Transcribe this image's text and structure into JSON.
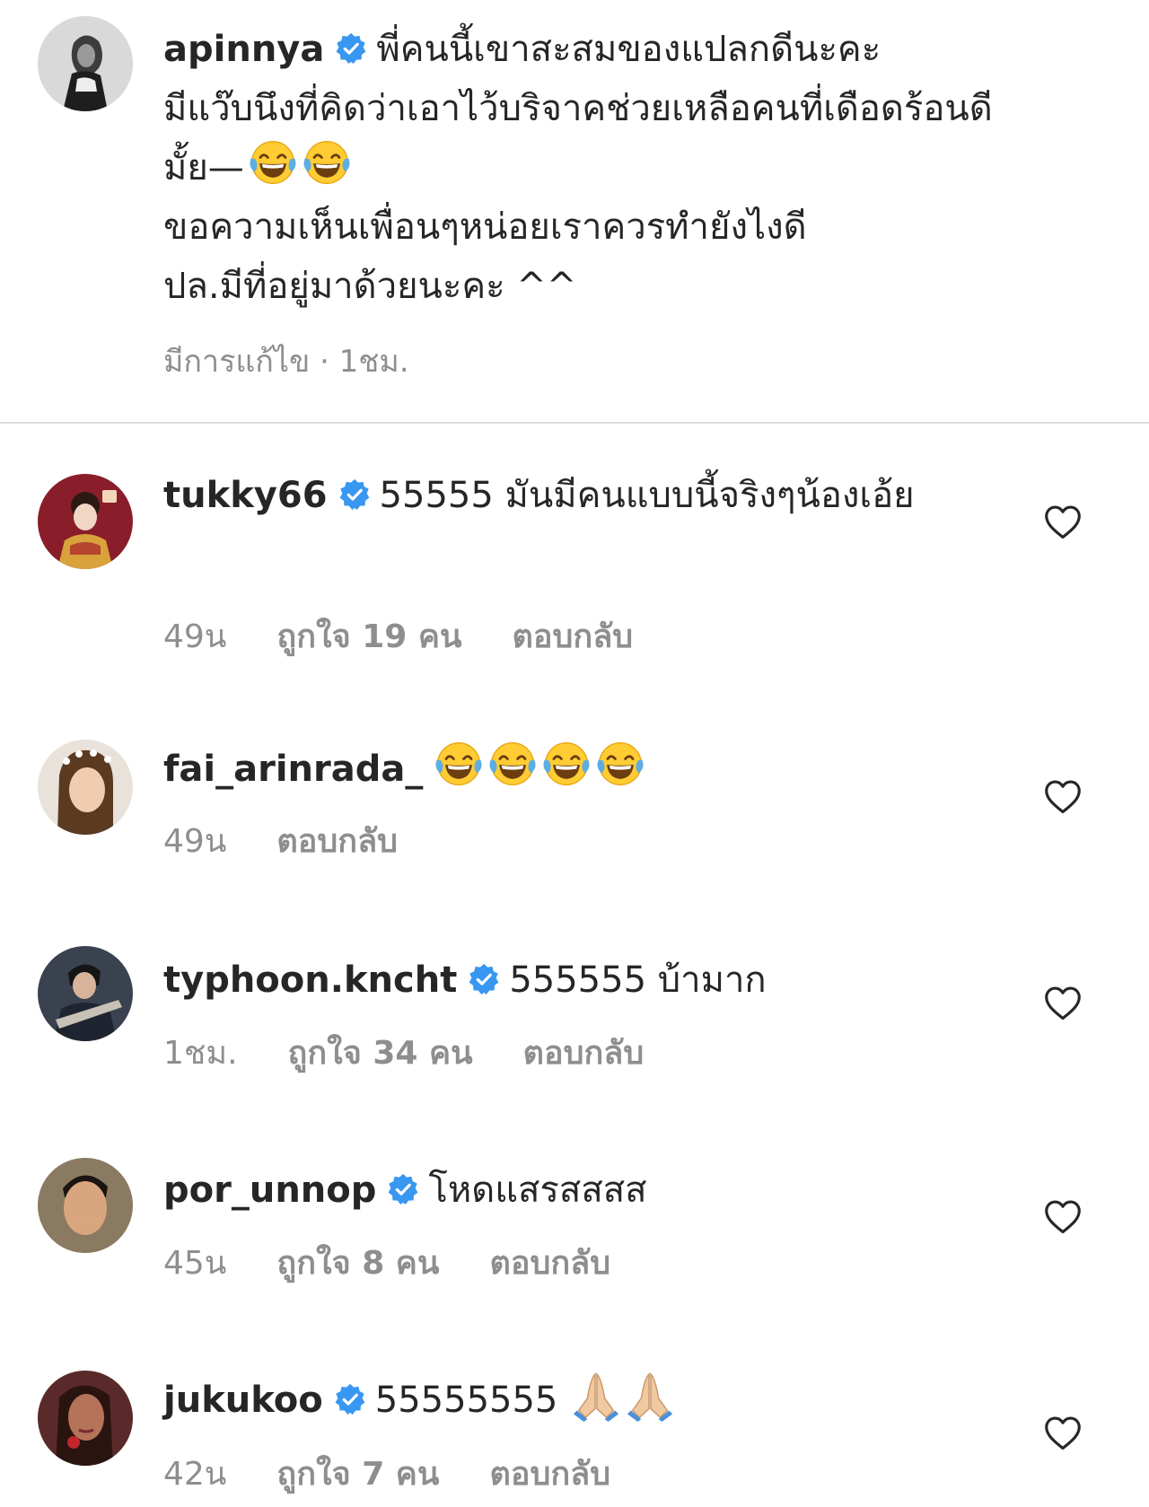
{
  "caption": {
    "username": "apinnya",
    "lines": [
      "พี่คนนี้เขาสะสมของแปลกดีนะคะ",
      "มีแว๊บนึงที่คิดว่าเอาไว้บริจาคช่วยเหลือคนที่เดือดร้อนดี",
      "มั้ย—",
      "ขอความเห็นเพื่อนๆหน่อยเราควรทำยังไงดี",
      "ปล.มีที่อยู่มาด้วยนะคะ ^^"
    ],
    "edited_label": "มีการแก้ไข · 1ชม."
  },
  "comments": [
    {
      "username": "tukky66",
      "verified": true,
      "text": "55555 มันมีคนแบบนี้จริงๆน้องเอ้ย",
      "time": "49น",
      "likes": "ถูกใจ 19 คน",
      "reply": "ตอบกลับ"
    },
    {
      "username": "fai_arinrada_",
      "verified": false,
      "text": "",
      "time": "49น",
      "likes": "",
      "reply": "ตอบกลับ"
    },
    {
      "username": "typhoon.knch t",
      "verified": true,
      "text": "555555 บ้ามาก",
      "time": "1ชม.",
      "likes": "ถูกใจ 34 คน",
      "reply": "ตอบกลับ"
    },
    {
      "username": "por_unnop",
      "verified": true,
      "text": "โหดแสรสสสส",
      "time": "45น",
      "likes": "ถูกใจ 8 คน",
      "reply": "ตอบกลับ"
    },
    {
      "username": "jukukoo",
      "verified": true,
      "text": "55555555",
      "time": "42น",
      "likes": "ถูกใจ 7 คน",
      "reply": "ตอบกลับ"
    }
  ],
  "colors": {
    "verified_blue": "#3897f0",
    "meta_gray": "#8e8e8e",
    "text_dark": "#262626",
    "divider": "#dbdbdb"
  },
  "icons": {
    "verified": "verified-badge-icon",
    "like": "heart-outline-icon",
    "laugh": "face-with-tears-of-joy-emoji",
    "pray": "folded-hands-emoji"
  }
}
